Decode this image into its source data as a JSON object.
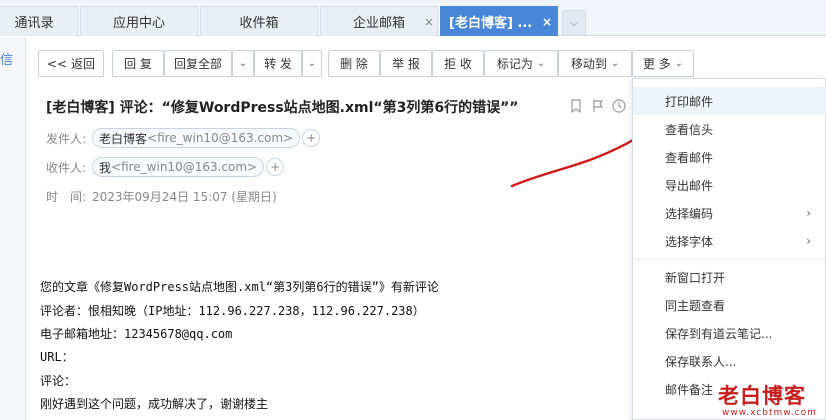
{
  "tabs": [
    {
      "label": "通讯录",
      "active": false
    },
    {
      "label": "应用中心",
      "active": false
    },
    {
      "label": "收件箱",
      "active": false
    },
    {
      "label": "企业邮箱",
      "active": false
    },
    {
      "label": "[老白博客] ...",
      "active": true
    }
  ],
  "tab_close_glyph": "×",
  "tab_more_icon": "chevron-down-icon",
  "sidebar_label": "信",
  "toolbar": {
    "back": "<< 返回",
    "reply": "回 复",
    "reply_all": "回复全部",
    "forward": "转 发",
    "delete": "删 除",
    "report": "举 报",
    "reject": "拒 收",
    "mark_as": "标记为",
    "move_to": "移动到",
    "more": "更 多",
    "caret": "⌄"
  },
  "email": {
    "subject": "[老白博客] 评论：“修复WordPress站点地图.xml“第3列第6行的错误””",
    "from_label": "发件人:",
    "from_name": "老白博客",
    "from_addr": "<fire_win10@163.com>",
    "to_label": "收件人:",
    "to_name": "我",
    "to_addr": "<fire_win10@163.com>",
    "time_label": "时　间:",
    "time_value": "2023年09月24日 15:07 (星期日)",
    "plus": "+",
    "body": [
      "您的文章《修复WordPress站点地图.xml“第3列第6行的错误”》有新评论",
      "评论者：恨相知晚（IP地址：112.96.227.238，112.96.227.238）",
      "电子邮箱地址：12345678@qq.com",
      "URL：",
      "评论：",
      "刚好遇到这个问题，成功解决了，谢谢楼主"
    ]
  },
  "more_menu": {
    "group1": [
      "打印邮件",
      "查看信头",
      "查看邮件",
      "导出邮件",
      "选择编码",
      "选择字体"
    ],
    "group2": [
      "新窗口打开",
      "同主题查看",
      "保存到有道云笔记...",
      "保存联系人...",
      "邮件备注"
    ],
    "submenu_arrow": "›"
  },
  "watermark": {
    "main": "老白博客",
    "sub": "www.xcbtmw.com"
  },
  "colors": {
    "accent": "#4a86d8",
    "annotation": "#d01818",
    "watermark": "#c81e1e"
  }
}
